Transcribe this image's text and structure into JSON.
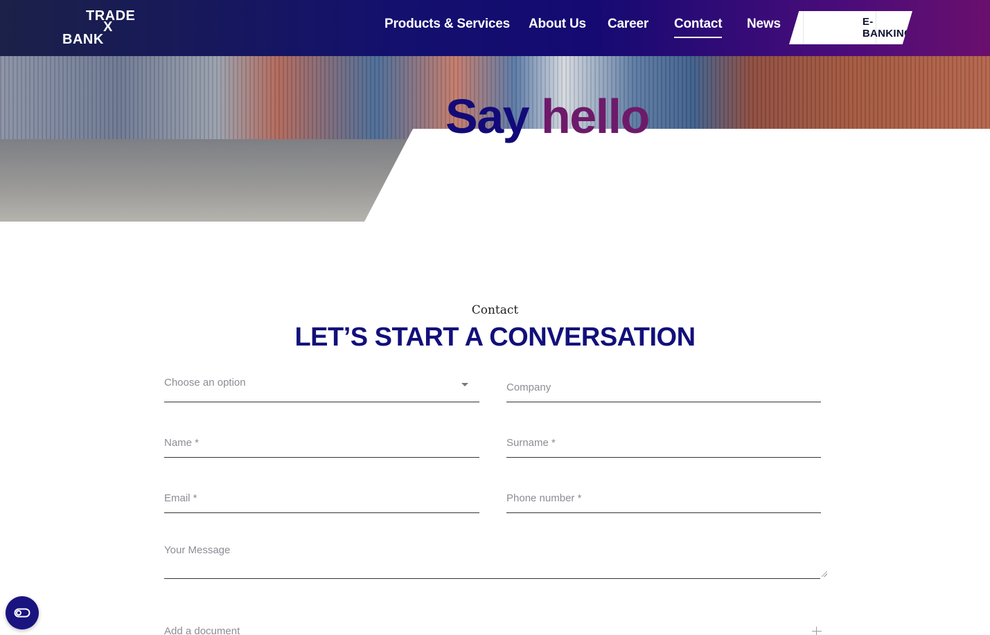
{
  "brand": {
    "line1": "TRADE",
    "line2": "X",
    "line3": "BANK"
  },
  "nav": {
    "items": [
      {
        "label": "Products & Services",
        "active": false
      },
      {
        "label": "About Us",
        "active": false
      },
      {
        "label": "Career",
        "active": false
      },
      {
        "label": "Contact",
        "active": true
      },
      {
        "label": "News",
        "active": false
      }
    ],
    "ebanking_label": "E-BANKING"
  },
  "hero": {
    "title_word1": "Say",
    "title_word2": "hello"
  },
  "contact": {
    "eyebrow": "Contact",
    "title": "LET’S START A CONVERSATION",
    "fields": {
      "topic": {
        "placeholder": "Choose an option"
      },
      "company": {
        "placeholder": "Company"
      },
      "name": {
        "placeholder": "Name *"
      },
      "surname": {
        "placeholder": "Surname *"
      },
      "email": {
        "placeholder": "Email *"
      },
      "phone": {
        "placeholder": "Phone number *"
      },
      "message": {
        "placeholder": "Your Message"
      },
      "document": {
        "label": "Add a document"
      }
    }
  },
  "colors": {
    "navy": "#12107a",
    "plum": "#6e1a6a",
    "header_start": "#1b2148",
    "header_end": "#6a0f6e"
  },
  "icons": {
    "accessibility": "accessibility-toggle-icon",
    "add": "plus-icon",
    "select": "chevron-down-icon"
  }
}
